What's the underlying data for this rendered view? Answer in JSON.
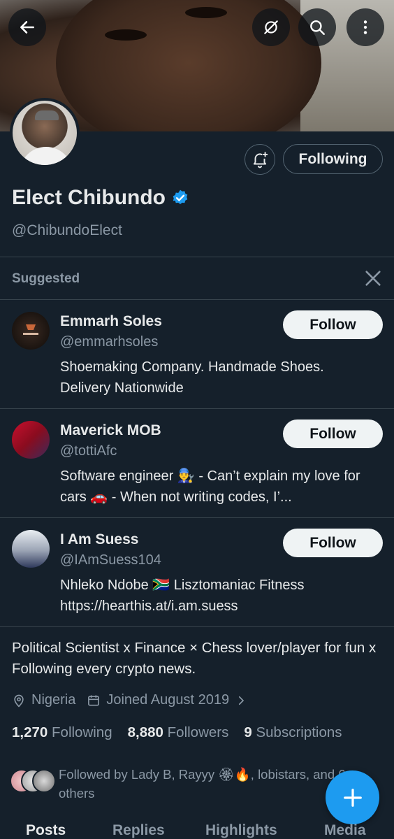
{
  "header": {
    "back_icon": "arrow-left-icon",
    "actions": [
      "grok-icon",
      "search-icon",
      "more-vertical-icon"
    ]
  },
  "profile": {
    "name": "Elect Chibundo",
    "handle": "@ChibundoElect",
    "verified": true,
    "following_label": "Following",
    "bell_icon": "bell-plus-icon",
    "bio": "Political Scientist x  Finance ×  Chess lover/player for fun x  Following every crypto news.",
    "location": "Nigeria",
    "joined": "Joined August 2019",
    "stats": [
      {
        "count": "1,270",
        "label": "Following"
      },
      {
        "count": "8,880",
        "label": "Followers"
      },
      {
        "count": "9",
        "label": "Subscriptions"
      }
    ],
    "followed_by": "Followed by Lady B, Rayyy 🏵🔥, lobistars, and 6 others"
  },
  "suggested": {
    "title": "Suggested",
    "items": [
      {
        "name": "Emmarh Soles",
        "handle": "@emmarhsoles",
        "bio": "Shoemaking Company. Handmade Shoes. Delivery Nationwide",
        "button": "Follow"
      },
      {
        "name": "Maverick MOB",
        "handle": "@tottiAfc",
        "bio": "Software engineer 👨‍🔧 - Can’t explain my love for cars 🚗 - When not writing codes, I’...",
        "button": "Follow"
      },
      {
        "name": "I Am Suess",
        "handle": "@IAmSuess104",
        "bio": "Nhleko Ndobe 🇿🇦 Lisztomaniac   Fitness https://hearthis.at/i.am.suess",
        "button": "Follow"
      }
    ]
  },
  "tabs": [
    "Posts",
    "Replies",
    "Highlights",
    "Media"
  ],
  "colors": {
    "accent": "#1d9bf0",
    "background": "#15202b",
    "muted": "#8b98a5"
  }
}
